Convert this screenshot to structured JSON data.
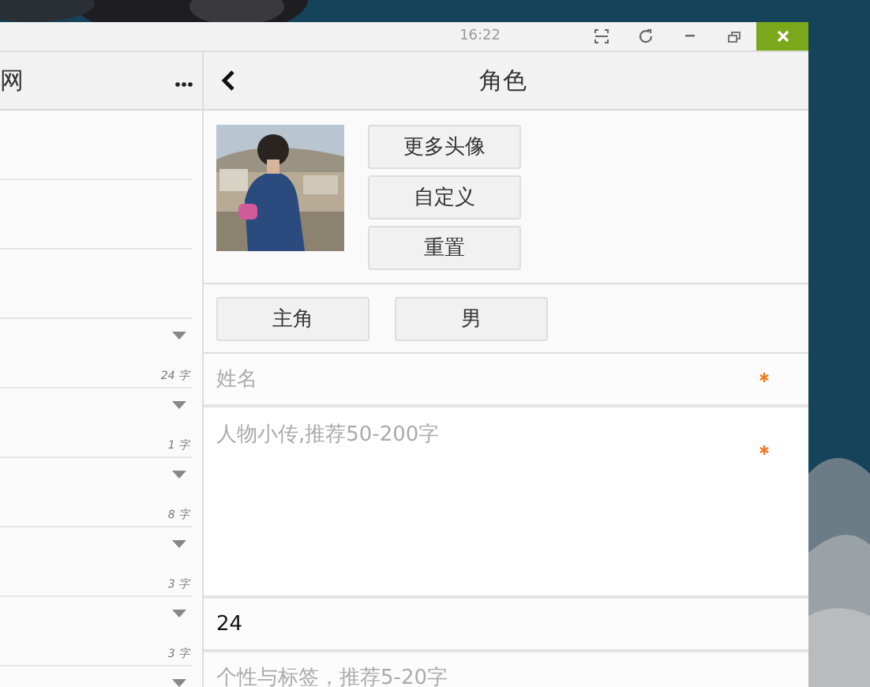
{
  "title_bar": {
    "time": "16:22"
  },
  "left_panel": {
    "title": "网",
    "rows": [
      {
        "kind": "blank"
      },
      {
        "kind": "blank"
      },
      {
        "kind": "blank"
      },
      {
        "kind": "collapsible",
        "count": "24 字"
      },
      {
        "kind": "collapsible",
        "count": "1 字"
      },
      {
        "kind": "collapsible",
        "count": "8 字"
      },
      {
        "kind": "collapsible",
        "count": "3 字"
      },
      {
        "kind": "collapsible",
        "count": "3 字"
      },
      {
        "kind": "collapsible"
      }
    ]
  },
  "character": {
    "title": "角色",
    "avatar": {
      "kind": "picture"
    },
    "avatar_buttons": [
      "更多头像",
      "自定义",
      "重置"
    ],
    "role_buttons": [
      "主角",
      "男"
    ],
    "fields": [
      {
        "kind": "input",
        "placeholder": "姓名",
        "required": true
      },
      {
        "kind": "textarea",
        "placeholder": "人物小传,推荐50-200字",
        "required": true
      },
      {
        "kind": "input",
        "value": "24",
        "required": false
      },
      {
        "kind": "input",
        "placeholder": "个性与标签，推荐5-20字",
        "required": false
      }
    ]
  }
}
